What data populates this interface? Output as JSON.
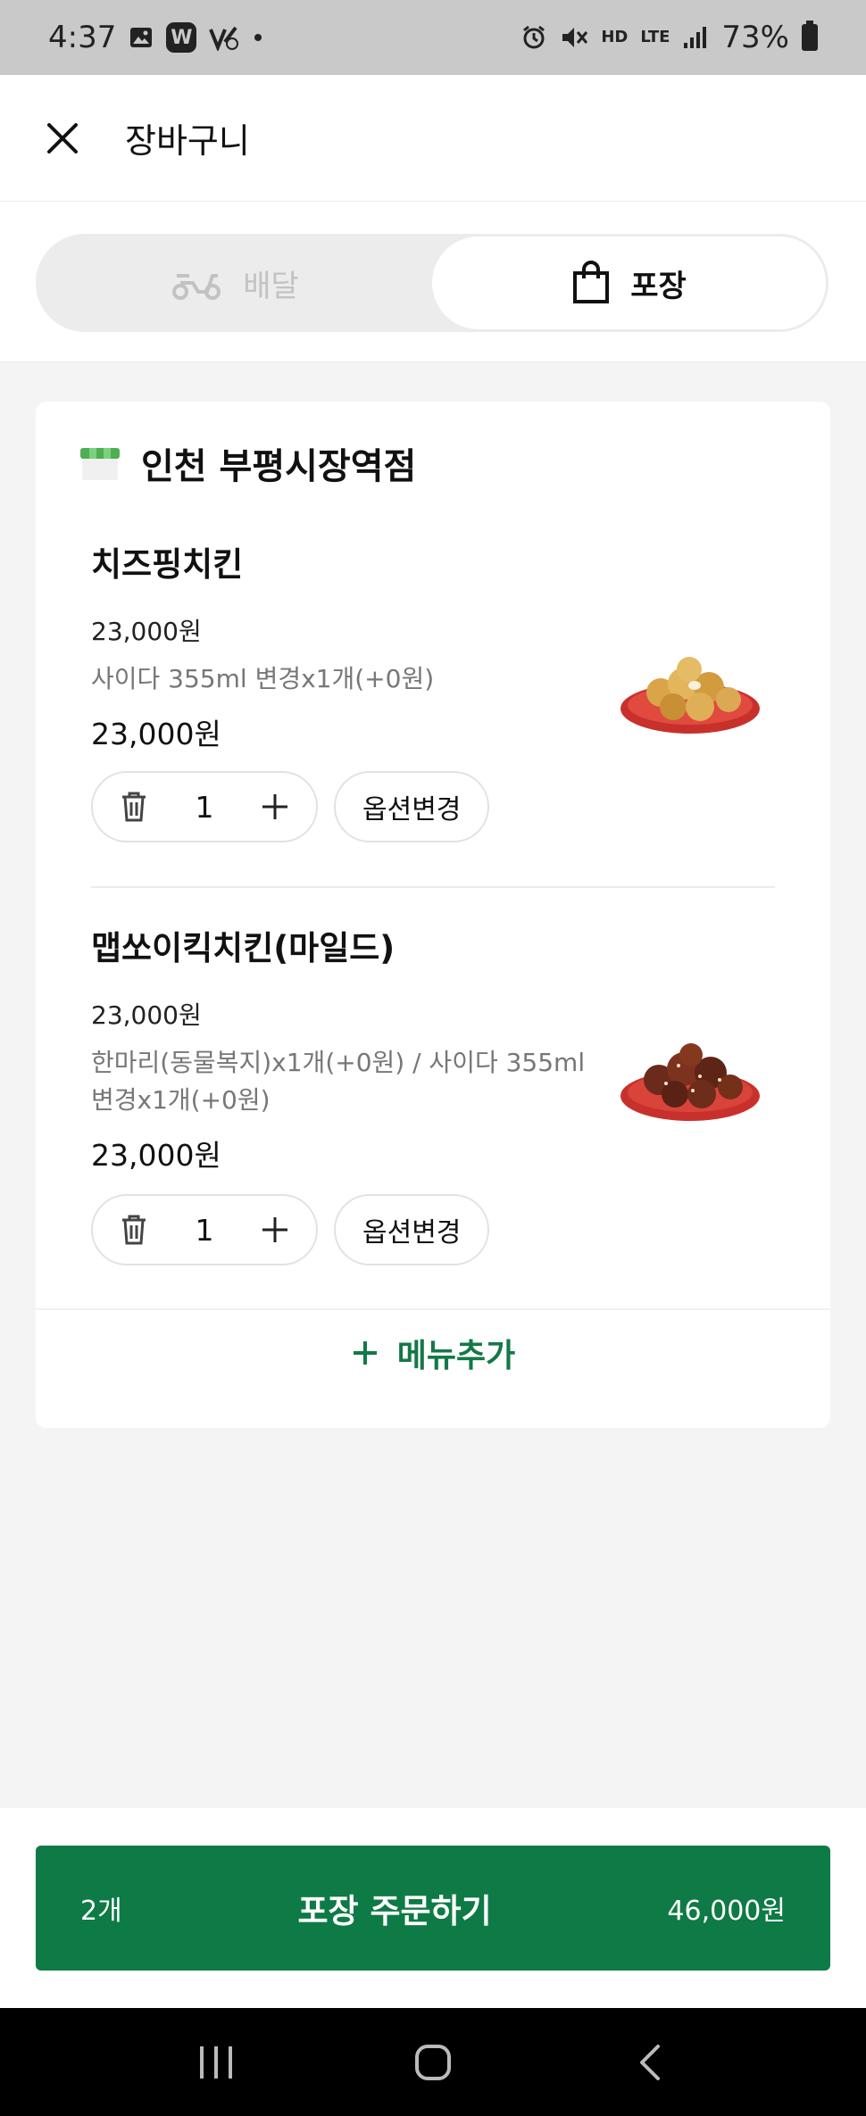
{
  "status_bar": {
    "time": "4:37",
    "battery": "73%",
    "notif_badge": "W",
    "net_hd": "HD",
    "net_lte": "LTE"
  },
  "header": {
    "title": "장바구니"
  },
  "order_type": {
    "delivery_label": "배달",
    "takeout_label": "포장",
    "selected": "takeout"
  },
  "store": {
    "name": "인천 부평시장역점"
  },
  "items": [
    {
      "name": "치즈핑치킨",
      "base_price": "23,000원",
      "options": "사이다 355ml 변경x1개(+0원)",
      "total": "23,000원",
      "quantity": "1",
      "option_button": "옵션변경"
    },
    {
      "name": "맵쏘이킥치킨(마일드)",
      "base_price": "23,000원",
      "options": "한마리(동물복지)x1개(+0원) / 사이다 355ml 변경x1개(+0원)",
      "total": "23,000원",
      "quantity": "1",
      "option_button": "옵션변경"
    }
  ],
  "add_menu": {
    "label": "메뉴추가"
  },
  "order_button": {
    "count": "2개",
    "label": "포장 주문하기",
    "price": "46,000원"
  },
  "colors": {
    "brand_green": "#0e7a45",
    "accent_green": "#137847"
  }
}
